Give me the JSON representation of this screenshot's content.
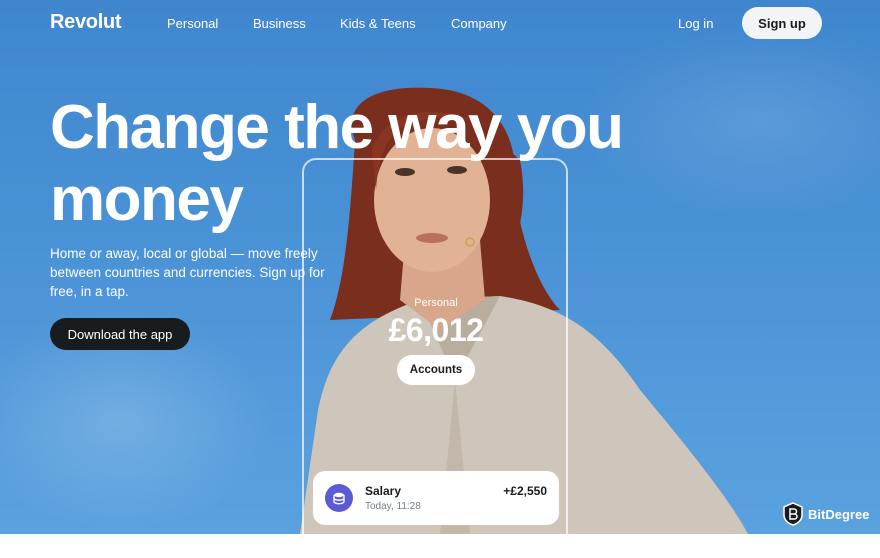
{
  "nav": {
    "logo": "Revolut",
    "links": [
      "Personal",
      "Business",
      "Kids & Teens",
      "Company"
    ],
    "login": "Log in",
    "signup": "Sign up"
  },
  "hero": {
    "headline_line1": "Change the way you",
    "headline_line2": "money",
    "subhead": "Home or away, local or global — move freely between countries and currencies. Sign up for free, in a tap.",
    "cta": "Download the app"
  },
  "phone": {
    "balance_label": "Personal",
    "balance_amount": "£6,012",
    "accounts_button": "Accounts",
    "transaction": {
      "title": "Salary",
      "subtitle": "Today, 11:28",
      "amount": "+£2,550",
      "icon": "coins-icon"
    }
  },
  "watermark": {
    "text": "BitDegree"
  },
  "colors": {
    "sky": "#4a92d6",
    "dark_button": "#191c1f",
    "light_button": "#f2f4f7",
    "tx_icon": "#5b5bd6"
  }
}
